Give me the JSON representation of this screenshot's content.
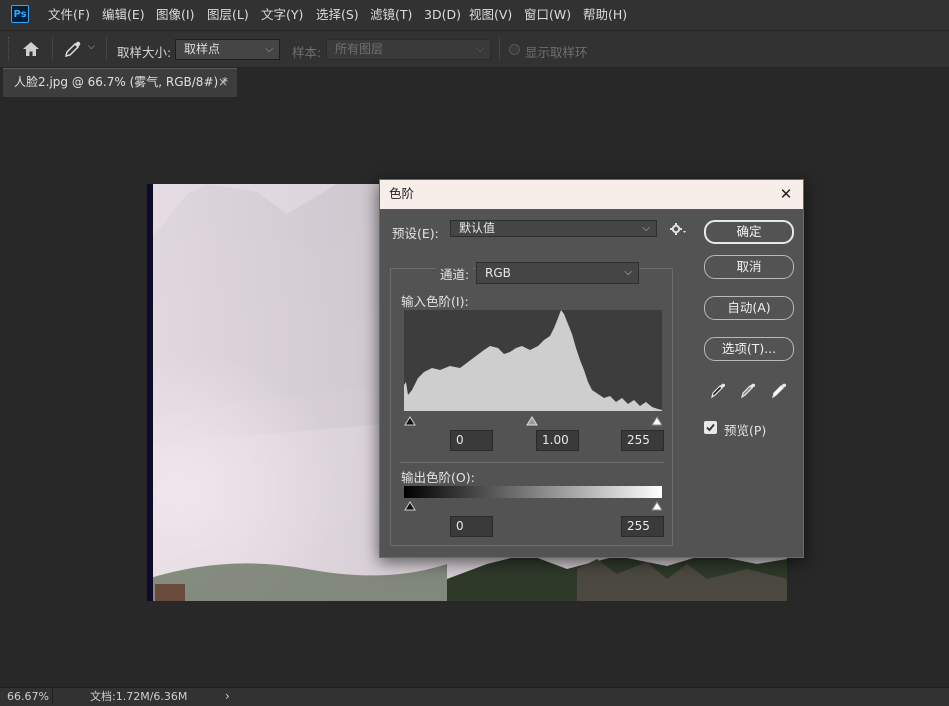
{
  "app": {
    "logo": "Ps"
  },
  "menu": [
    "文件(F)",
    "编辑(E)",
    "图像(I)",
    "图层(L)",
    "文字(Y)",
    "选择(S)",
    "滤镜(T)",
    "3D(D)",
    "视图(V)",
    "窗口(W)",
    "帮助(H)"
  ],
  "options": {
    "sample_size_label": "取样大小:",
    "sample_size_value": "取样点",
    "sample_label": "样本:",
    "sample_value": "所有图层",
    "show_ring_label": "显示取样环"
  },
  "tab": {
    "title": "人脸2.jpg @ 66.7% (雾气, RGB/8#) *",
    "close": "×"
  },
  "status": {
    "zoom": "66.67%",
    "doc": "文档:1.72M/6.36M",
    "arrow": "›"
  },
  "dialog": {
    "title": "色阶",
    "close": "✕",
    "preset_label": "预设(E):",
    "preset_value": "默认值",
    "channel_label": "通道:",
    "channel_value": "RGB",
    "input_label": "输入色阶(I):",
    "input_black": "0",
    "input_gamma": "1.00",
    "input_white": "255",
    "output_label": "输出色阶(O):",
    "output_black": "0",
    "output_white": "255",
    "buttons": {
      "ok": "确定",
      "cancel": "取消",
      "auto": "自动(A)",
      "options": "选项(T)..."
    },
    "preview_label": "预览(P)",
    "preview_checked": true,
    "accent": "#f8eee9"
  },
  "icons": [
    "ps-logo",
    "home-icon",
    "eyedropper-tool-icon",
    "chevron-down-icon",
    "gear-icon",
    "black-eyedropper-icon",
    "gray-eyedropper-icon",
    "white-eyedropper-icon",
    "close-icon"
  ]
}
